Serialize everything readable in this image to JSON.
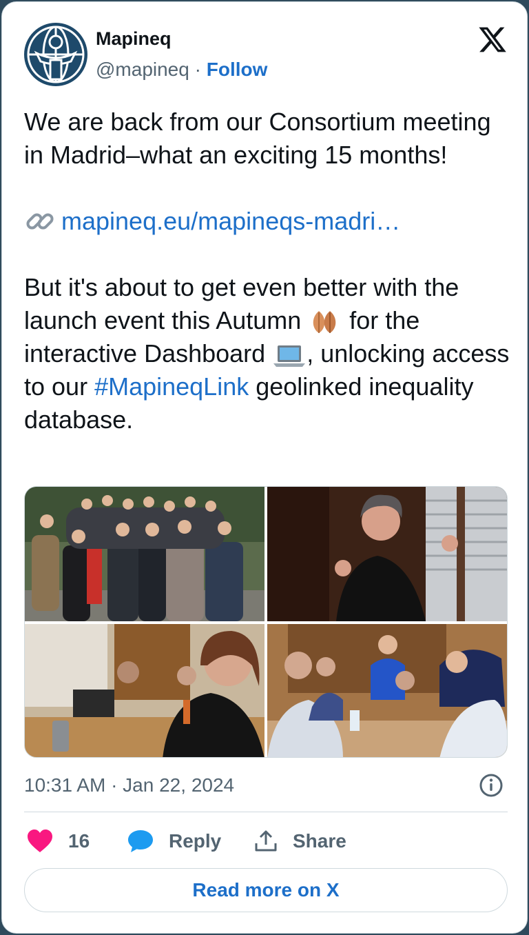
{
  "author": {
    "name": "Mapineq",
    "handle": "@mapineq",
    "separator": "·",
    "follow_label": "Follow"
  },
  "tweet": {
    "line1": "We are back from our Consortium meeting in Madrid–what an exciting 15 months!",
    "link_text": "mapineq.eu/mapineqs-madri…",
    "para2_a": "But it's about to get even better with the launch event this Autumn ",
    "para2_b": " for the interactive Dashboard ",
    "para2_c": ", unlocking access to our ",
    "hashtag": "#MapineqLink",
    "para2_d": " geolinked inequality database."
  },
  "meta": {
    "timestamp": "10:31 AM · Jan 22, 2024"
  },
  "actions": {
    "like_count": "16",
    "reply_label": "Reply",
    "share_label": "Share"
  },
  "read_more_label": "Read more on X",
  "icons": {
    "avatar": "mapineq-logo",
    "brand": "x-logo",
    "link": "link-icon",
    "leaves": "fallen-leaves-emoji",
    "laptop": "laptop-emoji",
    "info": "info-icon",
    "like": "heart-icon",
    "reply": "speech-bubble-icon",
    "share": "share-upload-icon"
  },
  "colors": {
    "link": "#1d6fc9",
    "like": "#f91880",
    "reply": "#1d9bf0",
    "avatar_bg": "#1e4a6b"
  }
}
